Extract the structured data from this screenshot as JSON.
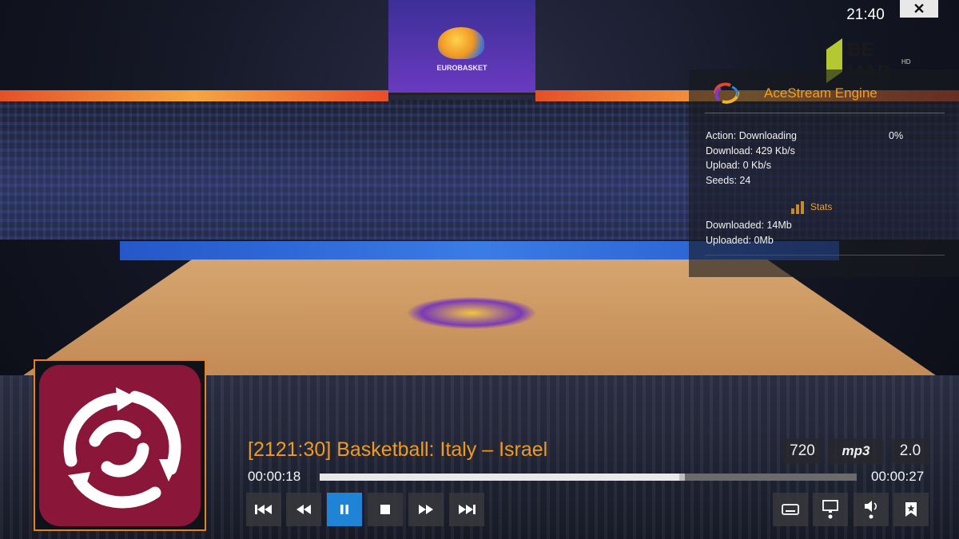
{
  "clock": "21:40",
  "close_label": "✕",
  "ace_panel": {
    "title": "AceStream Engine",
    "action_label": "Action:",
    "action_value": "Downloading",
    "percent": "0%",
    "download_label": "Download:",
    "download_value": "429 Kb/s",
    "upload_label": "Upload:",
    "upload_value": "0 Kb/s",
    "seeds_label": "Seeds:",
    "seeds_value": "24",
    "stats_label": "Stats",
    "downloaded_label": "Downloaded:",
    "downloaded_value": "14Mb",
    "uploaded_label": "Uploaded:",
    "uploaded_value": "0Mb"
  },
  "player": {
    "title": "[2121:30] Basketball: Italy – Israel",
    "time_current": "00:00:18",
    "time_total": "00:00:27",
    "played_fraction": 0.67,
    "buffered_fraction": 0.68,
    "badges": {
      "resolution": "720",
      "audio_codec": "mp3",
      "channels": "2.0"
    }
  },
  "controls": [
    "skip-back",
    "rewind",
    "pause",
    "stop",
    "fast-forward",
    "skip-forward"
  ],
  "aux_controls": [
    "subtitles",
    "video-settings",
    "audio-settings",
    "bookmark"
  ],
  "colors": {
    "accent": "#f29b19",
    "active_button": "#1f84d6",
    "channel_icon_bg": "#8a1739",
    "ace_title": "#f0a21e"
  }
}
